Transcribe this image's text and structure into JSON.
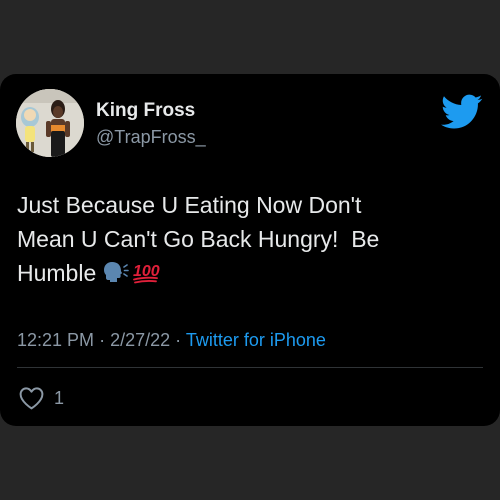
{
  "tweet": {
    "display_name": "King Fross",
    "handle": "@TrapFross_",
    "text": "Just Because U Eating Now Don't\nMean U Can't Go Back Hungry!  Be\nHumble",
    "emojis": [
      "speaking-head-icon",
      "hundred-points-icon"
    ],
    "time": "12:21 PM",
    "date": "2/27/22",
    "separator": "·",
    "source": "Twitter for iPhone",
    "likes": "1"
  },
  "colors": {
    "background": "#262626",
    "card": "#000000",
    "text_primary": "#e7e9ea",
    "text_secondary": "#8b98a5",
    "accent": "#1d9bf0",
    "hundred_red": "#e0203a"
  },
  "icons": {
    "brand": "twitter-bird-icon",
    "like": "heart-outline-icon"
  }
}
